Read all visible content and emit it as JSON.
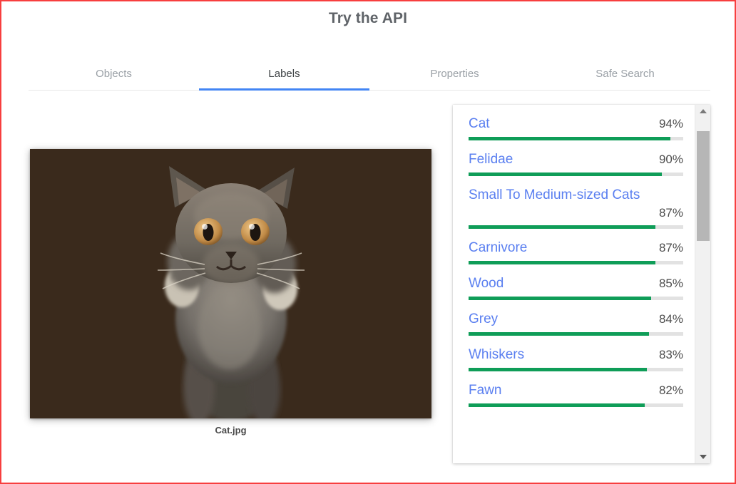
{
  "header": {
    "title": "Try the API"
  },
  "tabs": [
    {
      "label": "Objects",
      "active": false
    },
    {
      "label": "Labels",
      "active": true
    },
    {
      "label": "Properties",
      "active": false
    },
    {
      "label": "Safe Search",
      "active": false
    }
  ],
  "image": {
    "caption": "Cat.jpg",
    "alt": "grey cat standing upright on hind legs in front of blurred wooden background"
  },
  "labels": [
    {
      "name": "Cat",
      "percent": "94%",
      "value": 94,
      "wrapped": false
    },
    {
      "name": "Felidae",
      "percent": "90%",
      "value": 90,
      "wrapped": false
    },
    {
      "name": "Small To Medium-sized Cats",
      "percent": "87%",
      "value": 87,
      "wrapped": true
    },
    {
      "name": "Carnivore",
      "percent": "87%",
      "value": 87,
      "wrapped": false
    },
    {
      "name": "Wood",
      "percent": "85%",
      "value": 85,
      "wrapped": false
    },
    {
      "name": "Grey",
      "percent": "84%",
      "value": 84,
      "wrapped": false
    },
    {
      "name": "Whiskers",
      "percent": "83%",
      "value": 83,
      "wrapped": false
    },
    {
      "name": "Fawn",
      "percent": "82%",
      "value": 82,
      "wrapped": false
    }
  ],
  "colors": {
    "accent_blue": "#4285f4",
    "label_link": "#5a7ff0",
    "bar_green": "#0f9d58",
    "bar_track": "#e2e2e2",
    "frame_red": "#f73f3f"
  },
  "scrollbar": {
    "up_icon": "triangle-up-icon",
    "down_icon": "triangle-down-icon",
    "thumb_position_percent": 4,
    "thumb_size_percent": 33
  }
}
